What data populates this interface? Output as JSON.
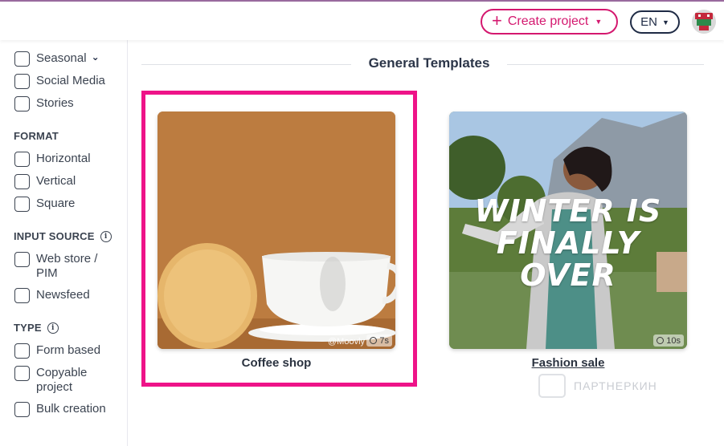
{
  "header": {
    "create_label": "Create project",
    "lang_label": "EN"
  },
  "sidebar": {
    "top_items": [
      "Seasonal",
      "Social Media",
      "Stories"
    ],
    "format": {
      "title": "FORMAT",
      "items": [
        "Horizontal",
        "Vertical",
        "Square"
      ]
    },
    "input_source": {
      "title": "INPUT SOURCE",
      "items": [
        "Web store / PIM",
        "Newsfeed"
      ]
    },
    "type": {
      "title": "TYPE",
      "items": [
        "Form based",
        "Copyable project",
        "Bulk creation"
      ]
    }
  },
  "main": {
    "section_title": "General Templates",
    "cards": [
      {
        "title": "Coffee shop",
        "duration": "7s",
        "watermark": "@Moovly"
      },
      {
        "title": "Fashion sale",
        "duration": "10s",
        "overlay_text": "WINTER IS FINALLY OVER"
      }
    ]
  },
  "corner_watermark": "ПАРТНЕРКИН",
  "colors": {
    "accent": "#d4186f",
    "highlight": "#ee1388",
    "coffee_bg": "#bc7c40",
    "navy": "#1f2b45"
  }
}
